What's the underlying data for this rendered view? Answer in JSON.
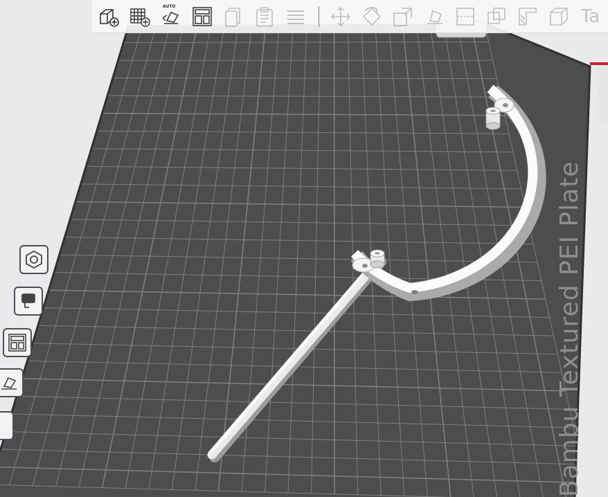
{
  "plate": {
    "label": "Bambu Textured PEI Plate",
    "color": "#4b4d4e",
    "grid_color": "#8e9192",
    "model_color": "#fbfbfb"
  },
  "toolbar": {
    "items": [
      {
        "id": "add",
        "icon": "add-object-icon",
        "enabled": true
      },
      {
        "id": "add-plate",
        "icon": "add-plate-icon",
        "enabled": true
      },
      {
        "id": "auto-orient",
        "icon": "auto-orient-icon",
        "label": "AUTO",
        "enabled": true
      },
      {
        "id": "arrange",
        "icon": "arrange-icon",
        "enabled": true
      },
      {
        "id": "copy",
        "icon": "copy-icon",
        "enabled": false
      },
      {
        "id": "paste",
        "icon": "paste-icon",
        "enabled": false
      },
      {
        "id": "layers",
        "icon": "layers-icon",
        "enabled": false
      },
      {
        "id": "move",
        "icon": "move-icon",
        "enabled": false
      },
      {
        "id": "rotate",
        "icon": "rotate-icon",
        "enabled": false
      },
      {
        "id": "scale",
        "icon": "scale-icon",
        "enabled": false
      },
      {
        "id": "lay-on-face",
        "icon": "lay-on-face-icon",
        "enabled": false
      },
      {
        "id": "cut",
        "icon": "cut-icon",
        "enabled": false
      },
      {
        "id": "boolean",
        "icon": "boolean-icon",
        "enabled": false
      },
      {
        "id": "support-paint",
        "icon": "support-paint-icon",
        "enabled": false
      },
      {
        "id": "seam",
        "icon": "seam-icon",
        "enabled": false
      },
      {
        "id": "text",
        "icon": "text-icon",
        "glyph": "Ta",
        "enabled": false
      }
    ]
  },
  "sidebar": {
    "items": [
      {
        "id": "plate-settings",
        "icon": "hexagon-icon"
      },
      {
        "id": "filament",
        "icon": "filament-icon"
      },
      {
        "id": "arrange",
        "icon": "arrange-icon"
      },
      {
        "id": "auto-orient",
        "icon": "auto-orient-icon"
      }
    ]
  }
}
